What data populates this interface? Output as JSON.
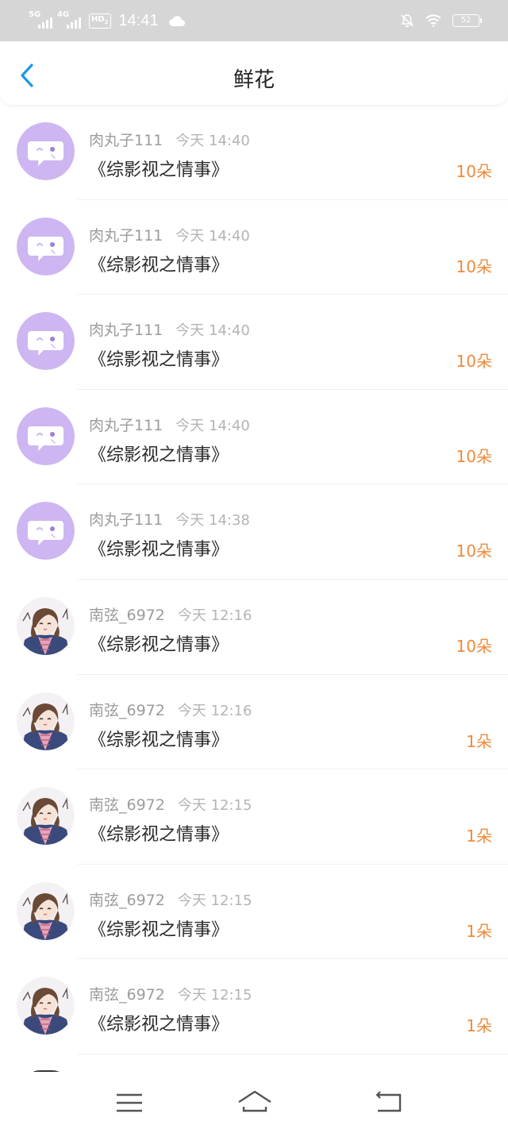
{
  "status_bar": {
    "network1": "5G",
    "network2": "4G",
    "hd": "HD",
    "hd_sub": "2",
    "time": "14:41",
    "battery": "52",
    "icons": [
      "cloud-icon",
      "bell-off-icon",
      "wifi-icon",
      "battery-icon"
    ]
  },
  "header": {
    "title": "鲜花",
    "back_icon": "chevron-left-icon",
    "accent": "#1a9ae0"
  },
  "items": [
    {
      "user": "肉丸子111",
      "time": "今天 14:40",
      "book": "《综影视之情事》",
      "count": "10朵",
      "avatar": "chat-bubble"
    },
    {
      "user": "肉丸子111",
      "time": "今天 14:40",
      "book": "《综影视之情事》",
      "count": "10朵",
      "avatar": "chat-bubble"
    },
    {
      "user": "肉丸子111",
      "time": "今天 14:40",
      "book": "《综影视之情事》",
      "count": "10朵",
      "avatar": "chat-bubble"
    },
    {
      "user": "肉丸子111",
      "time": "今天 14:40",
      "book": "《综影视之情事》",
      "count": "10朵",
      "avatar": "chat-bubble"
    },
    {
      "user": "肉丸子111",
      "time": "今天 14:38",
      "book": "《综影视之情事》",
      "count": "10朵",
      "avatar": "chat-bubble"
    },
    {
      "user": "南弦_6972",
      "time": "今天 12:16",
      "book": "《综影视之情事》",
      "count": "10朵",
      "avatar": "anime-girl"
    },
    {
      "user": "南弦_6972",
      "time": "今天 12:16",
      "book": "《综影视之情事》",
      "count": "1朵",
      "avatar": "anime-girl"
    },
    {
      "user": "南弦_6972",
      "time": "今天 12:15",
      "book": "《综影视之情事》",
      "count": "1朵",
      "avatar": "anime-girl"
    },
    {
      "user": "南弦_6972",
      "time": "今天 12:15",
      "book": "《综影视之情事》",
      "count": "1朵",
      "avatar": "anime-girl"
    },
    {
      "user": "南弦_6972",
      "time": "今天 12:15",
      "book": "《综影视之情事》",
      "count": "1朵",
      "avatar": "anime-girl"
    }
  ],
  "nav": {
    "icons": [
      "menu-icon",
      "home-icon",
      "back-icon"
    ]
  },
  "colors": {
    "count": "#ef8a3b",
    "avatar_bg": "#cdb6f2",
    "status_bar": "#d6d6d6"
  }
}
